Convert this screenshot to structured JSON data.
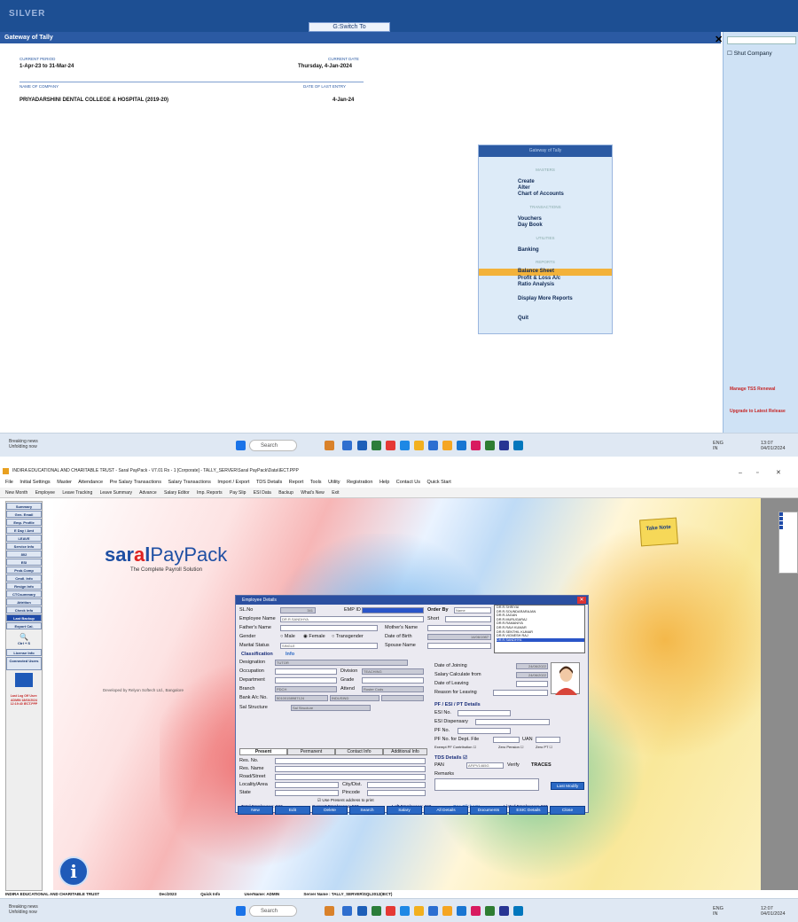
{
  "tally": {
    "brand": "SILVER",
    "goto_label": "G:Switch To",
    "subtitle": "Gateway of Tally",
    "current_period_label": "CURRENT PERIOD",
    "current_period": "1-Apr-23 to 31-Mar-24",
    "current_date_label": "CURRENT DATE",
    "current_date": "Thursday, 4-Jan-2024",
    "company_label": "NAME OF COMPANY",
    "last_entry_label": "DATE OF LAST ENTRY",
    "company": "PRIYADARSHINI DENTAL COLLEGE & HOSPITAL (2019-20)",
    "last_entry": "4-Jan-24",
    "shut_company": "Shut Company",
    "manage_tss": "Manage TSS Renewal",
    "upgrade": "Upgrade to Latest Release",
    "gateway": {
      "title": "Gateway of Tally",
      "masters": "MASTERS",
      "create": "Create",
      "alter": "Alter",
      "coa": "Chart of Accounts",
      "transactions": "TRANSACTIONS",
      "vouchers": "Vouchers",
      "daybook": "Day Book",
      "utilities": "UTILITIES",
      "banking": "Banking",
      "reports": "REPORTS",
      "balance_sheet": "Balance Sheet",
      "pl": "Profit & Loss A/c",
      "ratio": "Ratio Analysis",
      "more": "Display More Reports",
      "quit": "Quit"
    }
  },
  "taskbar": {
    "weather_line1": "Breaking news",
    "weather_line2": "Unfolding now",
    "search": "Search",
    "lang": "ENG",
    "lang2": "IN",
    "time": "13:07",
    "date": "04/01/2024",
    "time2": "12:07",
    "date2": "04/01/2024"
  },
  "saral": {
    "window_title": "INDIRA EDUCATIONAL AND CHARITABLE TRUST - Saral PayPack - V7.01 Rx - 1 [Corporate] - TALLY_SERVER\\Saral PayPack\\Data\\IECT.PPP",
    "menu": [
      "File",
      "Initial Settings",
      "Master",
      "Attendance",
      "Pre Salary Transactions",
      "Salary Transactions",
      "Import / Export",
      "TDS Details",
      "Report",
      "Tools",
      "Utility",
      "Registration",
      "Help",
      "Contact Us",
      "Quick Start"
    ],
    "toolbar": [
      "New Month",
      "Employee",
      "Leave Tracking",
      "Leave Summary",
      "Advance",
      "Salary Editor",
      "Imp. Reports",
      "Pay Slip",
      "ESI Data",
      "Backup",
      "What's New",
      "Exit"
    ],
    "nav": [
      "Summary",
      "Gen. Email",
      "Emp. Profile",
      "E Day / Amt",
      "LEAVE",
      "Service Info",
      "802",
      "ESI",
      "Prob.Comp",
      "Cmdl. Info",
      "Resign Info",
      "CTCsummary",
      "Attrition",
      "Check Info",
      "Last Backup",
      "Export Cal."
    ],
    "nav_search": "Ctrl + S",
    "license": "License Info",
    "connected": "Connected Users",
    "last_login": "Last Log Off User: ADMIN 18/03/2024 12:19:40 IECT.PPP",
    "logo_a": "sar",
    "logo_b": "a",
    "logo_c": "l",
    "logo_d": "PayPack",
    "tagline": "The Complete Payroll Solution",
    "developed_by": "Developed by Relyon Softech Ltd., Bangalore",
    "info": "i",
    "take_note": "Take Note",
    "status": {
      "trust": "INDIRA EDUCATIONAL AND CHARITABLE TRUST",
      "month": "Dec/2023",
      "quick_info": "Quick Info",
      "user": "UserName: ADMIN",
      "server": "Server Name : TALLY_SERVER\\SQL2012(IECT)"
    }
  },
  "employee": {
    "title": "Employee Details",
    "sl_no_label": "SL.No",
    "sl_no": "341",
    "emp_id_label": "EMP ID",
    "order_by": "Order By",
    "order_value": "Name",
    "short": "Short",
    "employee_name_label": "Employee Name",
    "employee_name": "DR.R.SANDHYA",
    "fathers_name": "Father's Name",
    "mothers_name": "Mother's Name",
    "gender": "Gender",
    "male": "Male",
    "female": "Female",
    "transgender": "Transgender",
    "dob_label": "Date of Birth",
    "dob": "14/06/1987",
    "marital_label": "Marital Status",
    "marital": "SINGLE",
    "spouse": "Spouse Name",
    "classification": "Classification",
    "info": "Info",
    "designation": "Designation",
    "designation_val": "TUTOR",
    "occupation": "Occupation",
    "department": "Department",
    "branch": "Branch",
    "branch_val": "PDCH",
    "bank": "Bank A/c No.",
    "bank_val": "50100158987124",
    "ifsc": "INDUSIND",
    "division": "Division",
    "division_val": "TEACHING",
    "grade": "Grade",
    "attend": "Attend",
    "attend_val": "Roster Cods",
    "esi_structure": "Sal Structure",
    "esi_structure_val": "Sal Structure",
    "doj": "Date of Joining",
    "doj_val": "24/06/2022",
    "salary_from": "Salary Calculate from",
    "salary_from_val": "24/06/2022",
    "dol": "Date of Leaving",
    "reason": "Reason for Leaving",
    "pf_section": "PF / ESI / PT Details",
    "esi_no": "ESI No.",
    "esi_disp": "ESI Dispensary",
    "pf_no": "PF No.",
    "pf_dept": "PF No. for Dept. File",
    "uan": "UAN",
    "exempt": "Exempt PF Contribution",
    "zero_pension": "Zero Pension",
    "zero_pf": "Zero PT",
    "tds_details": "TDS Details",
    "pan": "PAN",
    "pan_val": "AFIPV1465G",
    "verify": "Verify",
    "traces": "TRACES",
    "remarks": "Remarks",
    "last_modify": "Last Modify",
    "tabs": [
      "Present",
      "Permanent",
      "Contact Info",
      "Additional Info"
    ],
    "res_no": "Res. No.",
    "res_name": "Res. Name",
    "road": "Road/Street",
    "locality": "Locality/Area",
    "city": "City/Dist.",
    "state": "State",
    "pincode": "Pincode",
    "use_present": "Use Present address to print",
    "totals": {
      "total": "Total Employees: 923",
      "current": "Current Employees: 563",
      "left": "Left Employees: 360",
      "one_click": "One Click LIH",
      "listed": "Listed Employees: 923"
    },
    "buttons": [
      "New",
      "Edit",
      "Delete",
      "Search",
      "Salary",
      "All Details",
      "Documents",
      "ESIC Details",
      "Close"
    ],
    "list": [
      "DR.R.SHRIYAI",
      "DR.R.SOUNDARARAJAN",
      "DR.R.JAGAN",
      "DR.R.MURUGARAJ",
      "DR.R.RAMANIYA",
      "DR.R.RAVI KUMAR",
      "DR.R.SENTHIL KUMAR",
      "DR.R.VIGNESH RAJ",
      "DR.R.SANDHYA"
    ]
  },
  "colors": {
    "tally_blue": "#1d4f93",
    "highlight": "#f3b23a",
    "saral_blue": "#1e4fa3",
    "button_blue": "#2a68c4"
  }
}
